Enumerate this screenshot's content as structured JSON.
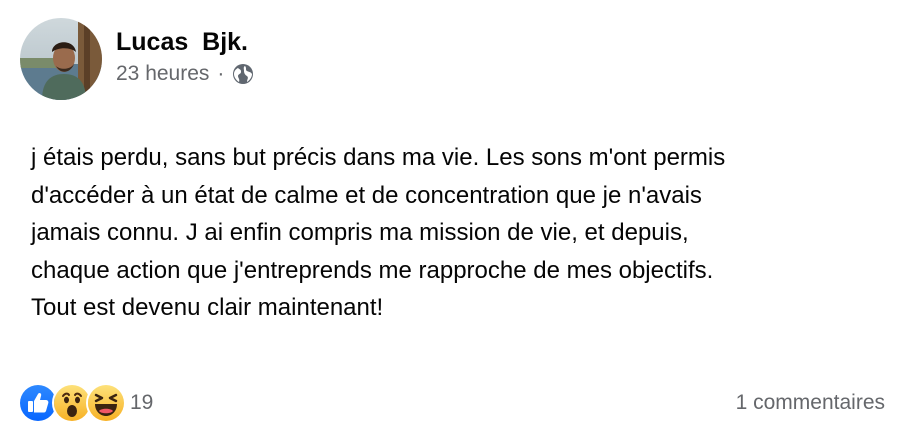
{
  "post": {
    "author": "Lucas  Bjk.",
    "timestamp": "23 heures",
    "separator": "·",
    "audience_icon": "globe-icon",
    "body_lines": [
      "j étais perdu, sans but précis dans ma vie. Les sons m'ont permis",
      "d'accéder à un état de calme et de concentration que je n'avais",
      "jamais connu. J ai enfin compris ma mission de vie, et depuis,",
      "chaque action que j'entreprends me rapproche de mes objectifs.",
      "Tout est devenu clair maintenant!"
    ],
    "reactions": {
      "icons": [
        "like-icon",
        "wow-icon",
        "haha-icon"
      ],
      "count": "19"
    },
    "comments_label": "1 commentaires"
  },
  "colors": {
    "like_blue": "#1877f2",
    "emoji_yellow": "#f7b125",
    "secondary_text": "#65676b",
    "primary_text": "#050505"
  }
}
